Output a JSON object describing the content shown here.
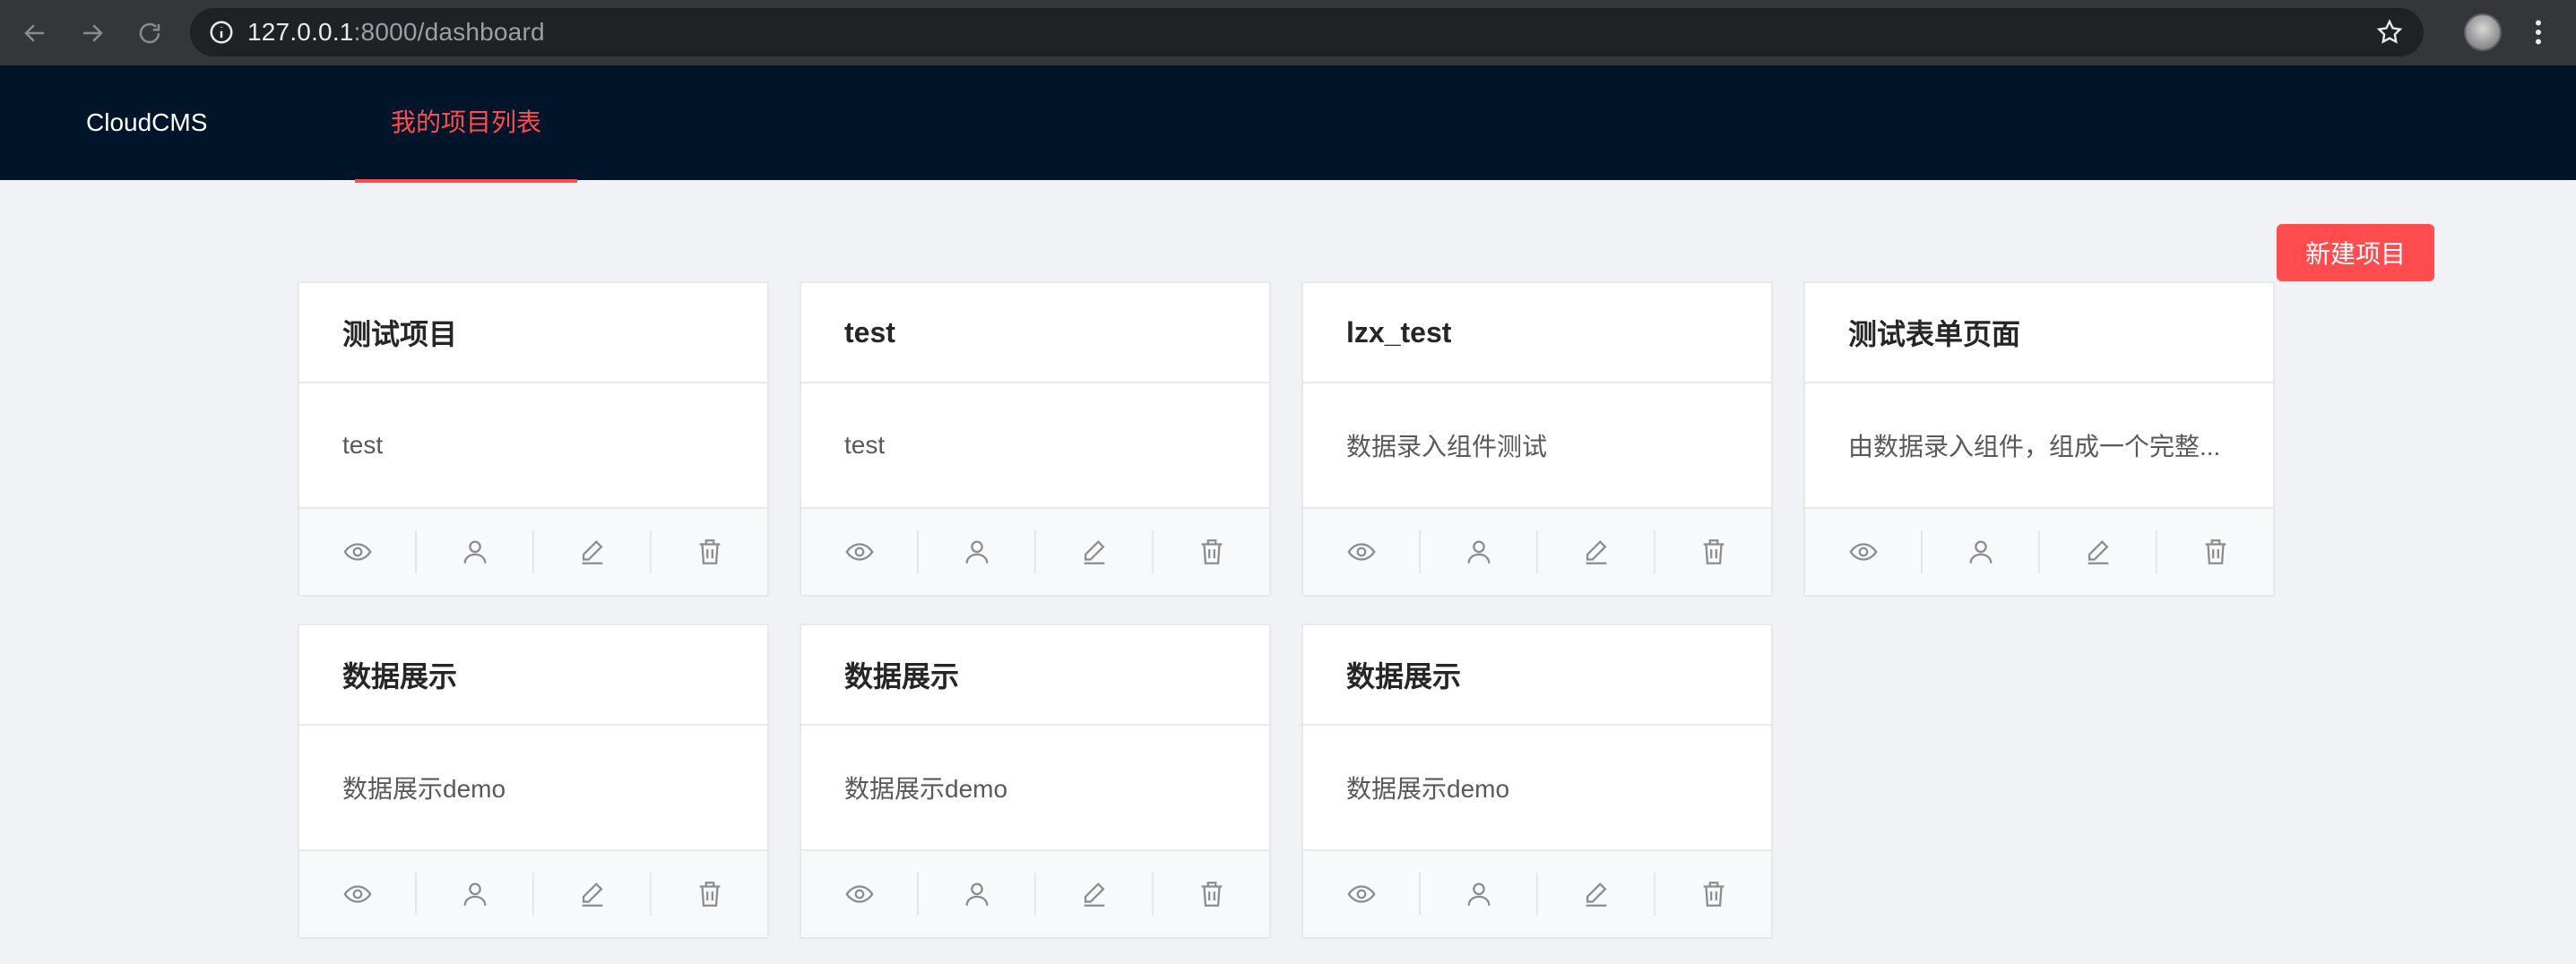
{
  "browser": {
    "url_host": "127.0.0.1",
    "url_rest": ":8000/dashboard"
  },
  "header": {
    "logo": "CloudCMS",
    "menu": [
      {
        "label": "我的项目列表",
        "active": true
      }
    ]
  },
  "toolbar": {
    "new_project_label": "新建项目"
  },
  "colors": {
    "accent": "#ff4d4f",
    "header_bg": "#001529",
    "page_bg": "#f0f2f5"
  },
  "projects": [
    {
      "title": "测试项目",
      "description": "test"
    },
    {
      "title": "test",
      "description": "test"
    },
    {
      "title": "lzx_test",
      "description": "数据录入组件测试"
    },
    {
      "title": "测试表单页面",
      "description": "由数据录入组件，组成一个完整..."
    },
    {
      "title": "数据展示",
      "description": "数据展示demo"
    },
    {
      "title": "数据展示",
      "description": "数据展示demo"
    },
    {
      "title": "数据展示",
      "description": "数据展示demo"
    }
  ],
  "card_actions": [
    "eye-icon",
    "user-icon",
    "edit-icon",
    "delete-icon"
  ]
}
